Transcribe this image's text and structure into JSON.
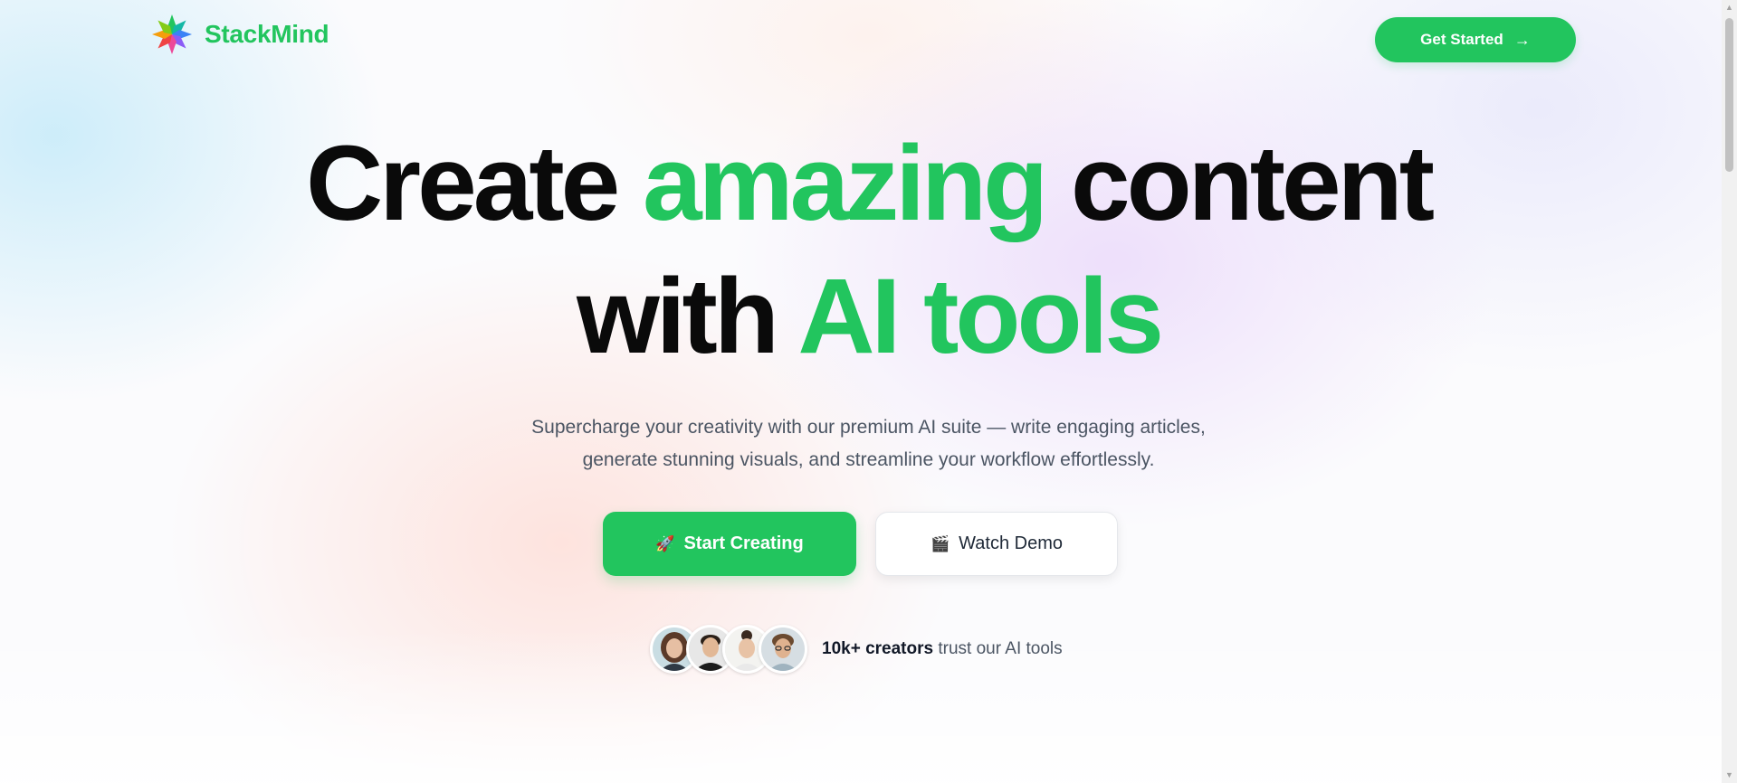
{
  "brand": {
    "name": "StackMind",
    "logo_icon": "pinwheel-logo-icon"
  },
  "nav": {
    "cta_label": "Get Started",
    "cta_icon": "arrow-right-icon"
  },
  "hero": {
    "line1": {
      "part1": "Create",
      "part2": "amazing",
      "part3": "content"
    },
    "line2": {
      "part1": "with",
      "part2": "AI tools"
    },
    "subtitle_line1": "Supercharge your creativity with our premium AI suite — write engaging articles,",
    "subtitle_line2": "generate stunning visuals, and streamline your workflow effortlessly."
  },
  "actions": {
    "primary": {
      "emoji": "🚀",
      "label": "Start Creating"
    },
    "secondary": {
      "emoji": "🎬",
      "label": "Watch Demo"
    }
  },
  "social_proof": {
    "count": "10k+ creators",
    "text": "trust our AI tools",
    "avatars": [
      "avatar-1",
      "avatar-2",
      "avatar-3",
      "avatar-4"
    ]
  },
  "colors": {
    "accent": "#22c55e",
    "heading": "#0a0a0a",
    "body_text": "#4b5563"
  }
}
